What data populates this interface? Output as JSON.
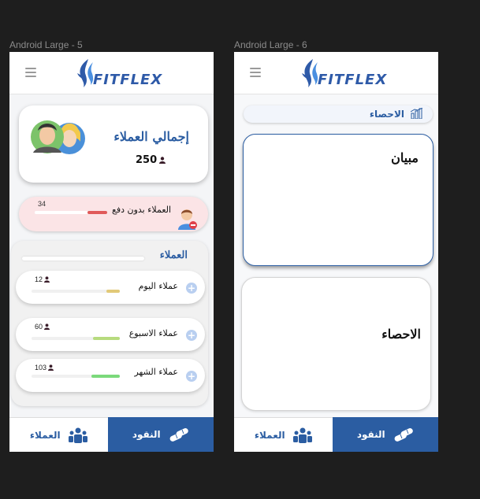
{
  "frames": [
    {
      "label": "Android Large - 5"
    },
    {
      "label": "Android Large - 6"
    }
  ],
  "brand": {
    "logo_text": "FITFLEX",
    "primary_color": "#2b5da2",
    "accent_color": "#4a8fe0"
  },
  "nav": {
    "clients_label": "العملاء",
    "money_label": "النقود",
    "clients_icon": "people-icon",
    "money_icon": "money-pills-icon"
  },
  "screen5": {
    "total": {
      "title": "إجمالي العملاء",
      "count": "250"
    },
    "unpaid": {
      "label": "العملاء بدون دفع",
      "count": "34",
      "progress": 0.27,
      "color": "#e05a5a"
    },
    "clients": {
      "title": "العملاء",
      "rows": [
        {
          "label": "عملاء اليوم",
          "count": "12",
          "progress": 0.15,
          "color": "#e2c978"
        },
        {
          "label": "عملاء الاسبوع",
          "count": "60",
          "progress": 0.3,
          "color": "#b7db7e"
        },
        {
          "label": "عملاء الشهر",
          "count": "103",
          "progress": 0.32,
          "color": "#7bd97b"
        }
      ]
    }
  },
  "screen6": {
    "stats_bar_label": "الاحصاء",
    "chart_card_title": "مبيان",
    "stats_card_title": "الاحصاء"
  }
}
